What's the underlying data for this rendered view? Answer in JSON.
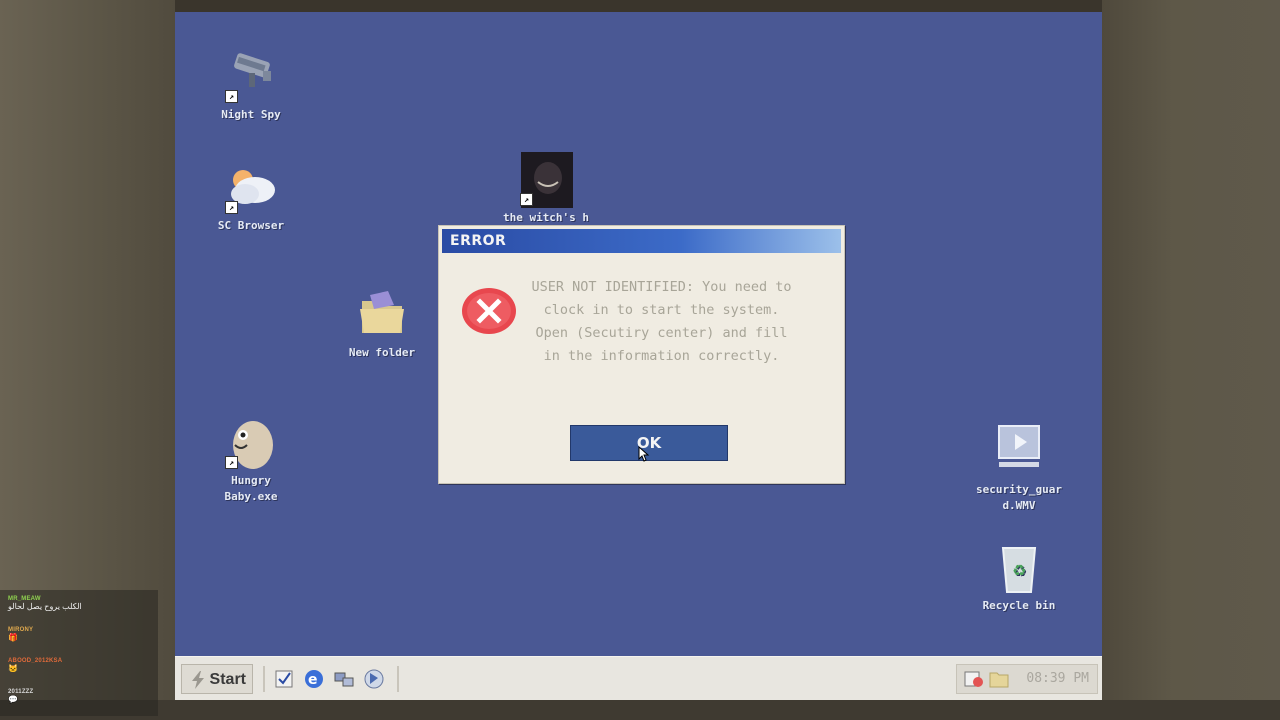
{
  "desktop": {
    "icons": [
      {
        "label": "Night Spy",
        "icon": "security-camera-icon"
      },
      {
        "label": "SC Browser",
        "icon": "cloud-sun-icon"
      },
      {
        "label": "New folder",
        "icon": "folder-icon"
      },
      {
        "label": "Hungry Baby.exe",
        "icon": "egg-creature-icon"
      },
      {
        "label": "the witch's h",
        "icon": "witch-portrait-icon"
      },
      {
        "label": "security_guard.WMV",
        "icon": "video-file-icon"
      },
      {
        "label": "Recycle bin",
        "icon": "recycle-bin-icon"
      }
    ]
  },
  "dialog": {
    "title": "ERROR",
    "icon": "error-x-icon",
    "message": "USER NOT IDENTIFIED: You need to clock in to start the system. Open (Secutiry center) and fill in the information correctly.",
    "ok_label": "OK"
  },
  "taskbar": {
    "start_label": "Start",
    "quick_launch": [
      "checklist-icon",
      "browser-e-icon",
      "network-icon",
      "arrow-tool-icon"
    ],
    "tray_icons": [
      "calendar-clock-icon",
      "folder-small-icon"
    ],
    "clock": "08:39 PM"
  },
  "chat": [
    {
      "user": "MR_MEAW",
      "text": "الكلب يروح يصل لحالو",
      "color": "#8fd14f"
    },
    {
      "user": "MIRONY",
      "text": "",
      "color": "#e0a94e",
      "emote": "🎁"
    },
    {
      "user": "ABOOD_2012KSA",
      "text": "",
      "color": "#e06a3a",
      "emote": "🐱"
    },
    {
      "user": "2011ZZZ",
      "text": "",
      "color": "#d9d9d9",
      "emote": "💬"
    }
  ],
  "colors": {
    "desktop": "#4a5894",
    "title_gradient_start": "#2a4ba4",
    "ok_button": "#3a5a9a",
    "error_red": "#e8474e"
  }
}
